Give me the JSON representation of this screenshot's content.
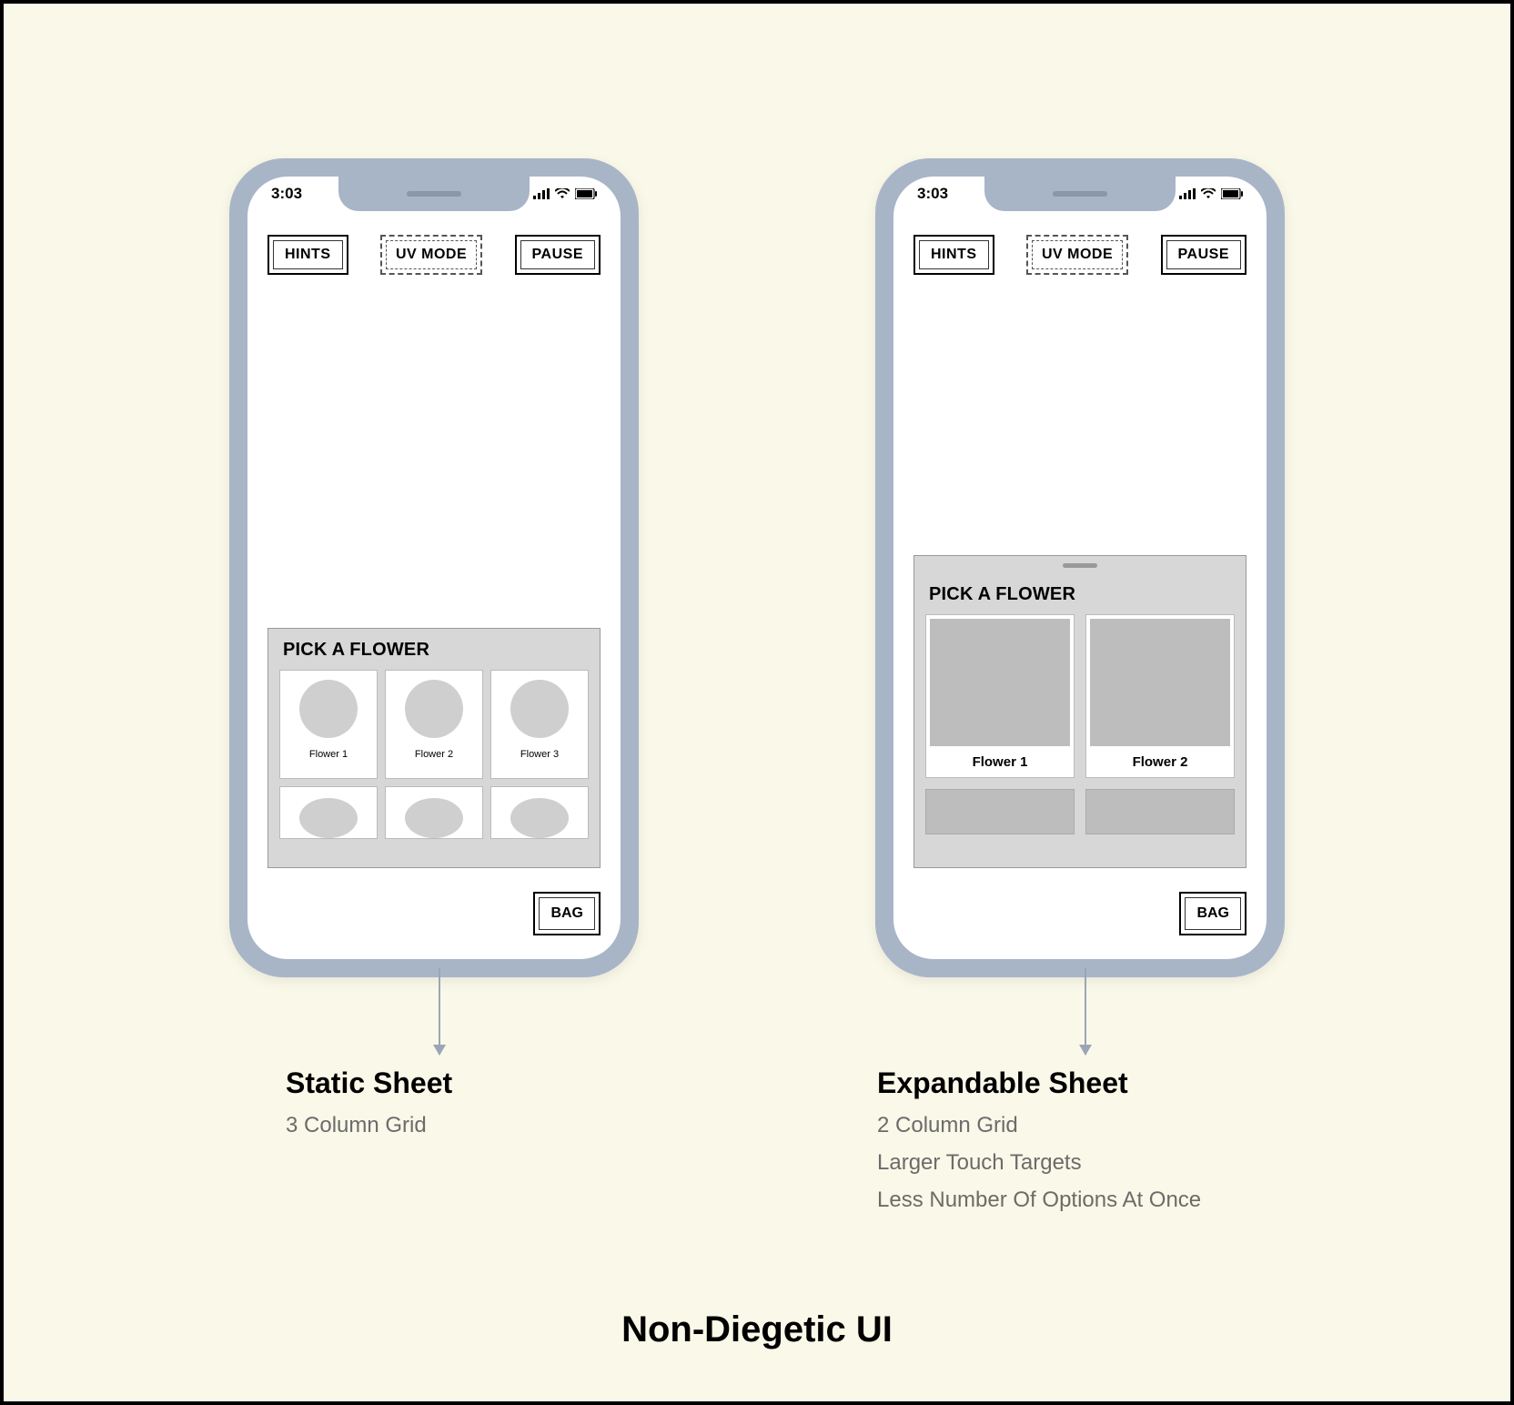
{
  "page_title": "Non-Diegetic UI",
  "statusbar": {
    "time": "3:03"
  },
  "hud": {
    "hints": "HINTS",
    "uvmode": "UV MODE",
    "pause": "PAUSE"
  },
  "bag_label": "BAG",
  "sheet_title": "PICK A FLOWER",
  "left_phone": {
    "flowers_row1": [
      "Flower 1",
      "Flower 2",
      "Flower 3"
    ]
  },
  "right_phone": {
    "flowers_row1": [
      "Flower 1",
      "Flower 2"
    ]
  },
  "captions": {
    "left": {
      "title": "Static Sheet",
      "lines": [
        "3 Column Grid"
      ]
    },
    "right": {
      "title": "Expandable Sheet",
      "lines": [
        "2 Column Grid",
        "Larger Touch Targets",
        "Less Number Of Options At Once"
      ]
    }
  }
}
